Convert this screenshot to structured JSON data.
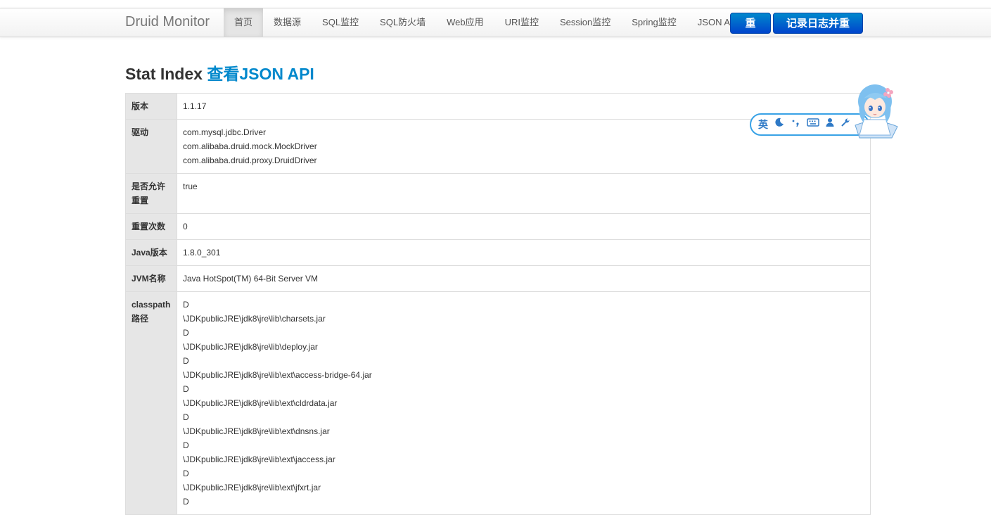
{
  "navbar": {
    "brand": "Druid Monitor",
    "items": [
      "首页",
      "数据源",
      "SQL监控",
      "SQL防火墙",
      "Web应用",
      "URI监控",
      "Session监控",
      "Spring监控",
      "JSON API"
    ],
    "active_index": 0,
    "reset_label": "重置",
    "log_reset_label": "记录日志并重置"
  },
  "page": {
    "title": "Stat Index",
    "json_link": "查看JSON API"
  },
  "stats": [
    {
      "key": "版本",
      "values": [
        "1.1.17"
      ]
    },
    {
      "key": "驱动",
      "values": [
        "com.mysql.jdbc.Driver",
        "com.alibaba.druid.mock.MockDriver",
        "com.alibaba.druid.proxy.DruidDriver"
      ]
    },
    {
      "key": "是否允许重置",
      "values": [
        "true"
      ]
    },
    {
      "key": "重置次数",
      "values": [
        "0"
      ]
    },
    {
      "key": "Java版本",
      "values": [
        "1.8.0_301"
      ]
    },
    {
      "key": "JVM名称",
      "values": [
        "Java HotSpot(TM) 64-Bit Server VM"
      ]
    },
    {
      "key": "classpath路径",
      "values": [
        "D",
        "\\JDKpublicJRE\\jdk8\\jre\\lib\\charsets.jar",
        "D",
        "\\JDKpublicJRE\\jdk8\\jre\\lib\\deploy.jar",
        "D",
        "\\JDKpublicJRE\\jdk8\\jre\\lib\\ext\\access-bridge-64.jar",
        "D",
        "\\JDKpublicJRE\\jdk8\\jre\\lib\\ext\\cldrdata.jar",
        "D",
        "\\JDKpublicJRE\\jdk8\\jre\\lib\\ext\\dnsns.jar",
        "D",
        "\\JDKpublicJRE\\jdk8\\jre\\lib\\ext\\jaccess.jar",
        "D",
        "\\JDKpublicJRE\\jdk8\\jre\\lib\\ext\\jfxrt.jar",
        "D"
      ]
    }
  ],
  "ime": {
    "lang_label": "英",
    "icons": [
      "moon-icon",
      "punctuation-icon",
      "keyboard-icon",
      "user-icon",
      "wrench-icon"
    ]
  },
  "colors": {
    "accent": "#0088cc",
    "button": "#0055cc",
    "key_cell": "#e6e6e6",
    "ime_border": "#39a2e6"
  }
}
